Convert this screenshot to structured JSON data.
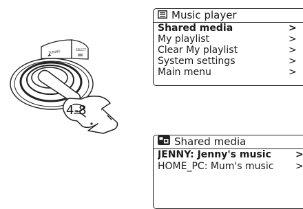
{
  "illustration": {
    "callout_text": "4-8",
    "button_labels": {
      "left": "TUNING",
      "right": "SELECT"
    }
  },
  "screen1": {
    "title": "Music player",
    "title_icon": "music-player-list-icon",
    "items": [
      {
        "label": "Shared media",
        "arrow": ">",
        "selected": true
      },
      {
        "label": "My playlist",
        "arrow": ">",
        "selected": false
      },
      {
        "label": "Clear My playlist",
        "arrow": ">",
        "selected": false
      },
      {
        "label": "System settings",
        "arrow": ">",
        "selected": false
      },
      {
        "label": "Main menu",
        "arrow": ">",
        "selected": false
      }
    ]
  },
  "screen2": {
    "title": "Shared media",
    "title_icon": "shared-media-icon",
    "items": [
      {
        "label": "JENNY: Jenny's music",
        "arrow": ">",
        "selected": true
      },
      {
        "label": "HOME_PC: Mum's music",
        "arrow": ">",
        "selected": false
      }
    ]
  }
}
